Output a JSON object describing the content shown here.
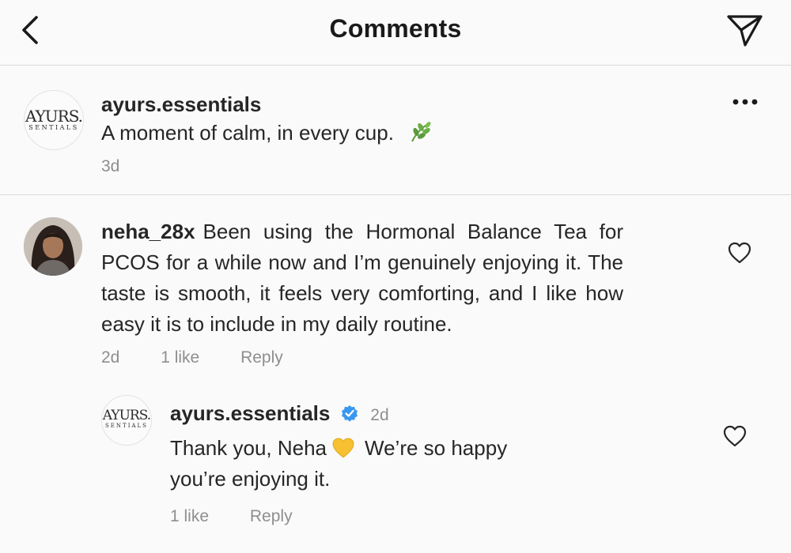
{
  "header": {
    "title": "Comments",
    "back_icon": "chevron-left-icon",
    "share_icon": "paper-plane-icon"
  },
  "caption": {
    "avatar_logo": {
      "top": "AYURS.",
      "bottom": "SENTIALS"
    },
    "username": "ayurs.essentials",
    "text": "A moment of calm, in every cup.",
    "emoji": "leaf-icon",
    "time": "3d",
    "more_icon": "more-options-icon"
  },
  "comment": {
    "username": "neha_28x",
    "text": "Been using the Hormonal Balance Tea for PCOS for a while now and I’m genuinely enjoying it. The taste is smooth, it feels very comforting, and I like how easy it is to include in my daily routine.",
    "time": "2d",
    "likes": "1 like",
    "reply_label": "Reply",
    "like_icon": "heart-outline-icon"
  },
  "reply": {
    "avatar_logo": {
      "top": "AYURS.",
      "bottom": "SENTIALS"
    },
    "username": "ayurs.essentials",
    "verified_icon": "verified-badge-icon",
    "time": "2d",
    "text_before": "Thank you, Neha",
    "emoji": "yellow-heart-icon",
    "text_after": "We’re so happy you’re enjoying it.",
    "likes": "1 like",
    "reply_label": "Reply",
    "like_icon": "heart-outline-icon"
  },
  "colors": {
    "background": "#fafafa",
    "text": "#262626",
    "secondary_text": "#8e8e8e",
    "divider": "#dbdbdb",
    "verified_blue": "#3897f0",
    "leaf_green": "#5a9a3c",
    "heart_yellow": "#f6c032"
  }
}
